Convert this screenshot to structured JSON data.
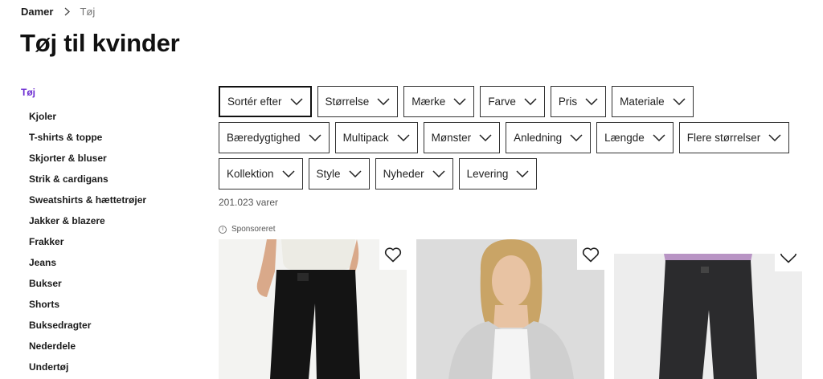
{
  "breadcrumb": {
    "parent": "Damer",
    "current": "Tøj"
  },
  "page": {
    "title": "Tøj til kvinder"
  },
  "sidebar": {
    "heading": "Tøj",
    "items": [
      {
        "label": "Kjoler"
      },
      {
        "label": "T-shirts & toppe"
      },
      {
        "label": "Skjorter & bluser"
      },
      {
        "label": "Strik & cardigans"
      },
      {
        "label": "Sweatshirts & hættetrøjer"
      },
      {
        "label": "Jakker & blazere"
      },
      {
        "label": "Frakker"
      },
      {
        "label": "Jeans"
      },
      {
        "label": "Bukser"
      },
      {
        "label": "Shorts"
      },
      {
        "label": "Buksedragter"
      },
      {
        "label": "Nederdele"
      },
      {
        "label": "Undertøj"
      }
    ]
  },
  "filters": {
    "row1": [
      "Sortér efter",
      "Størrelse",
      "Mærke",
      "Farve",
      "Pris",
      "Materiale"
    ],
    "row2": [
      "Bæredygtighed",
      "Multipack",
      "Mønster",
      "Anledning",
      "Længde",
      "Flere størrelser"
    ],
    "row3": [
      "Kollektion",
      "Style",
      "Nyheder",
      "Levering"
    ]
  },
  "results": {
    "count": "201.023 varer",
    "sponsored": "Sponsoreret"
  },
  "icons": {
    "chevron": "chevron-down-icon",
    "wishlist": "heart-icon",
    "info": "info-icon"
  },
  "colors": {
    "accent": "#6b2bd1"
  }
}
